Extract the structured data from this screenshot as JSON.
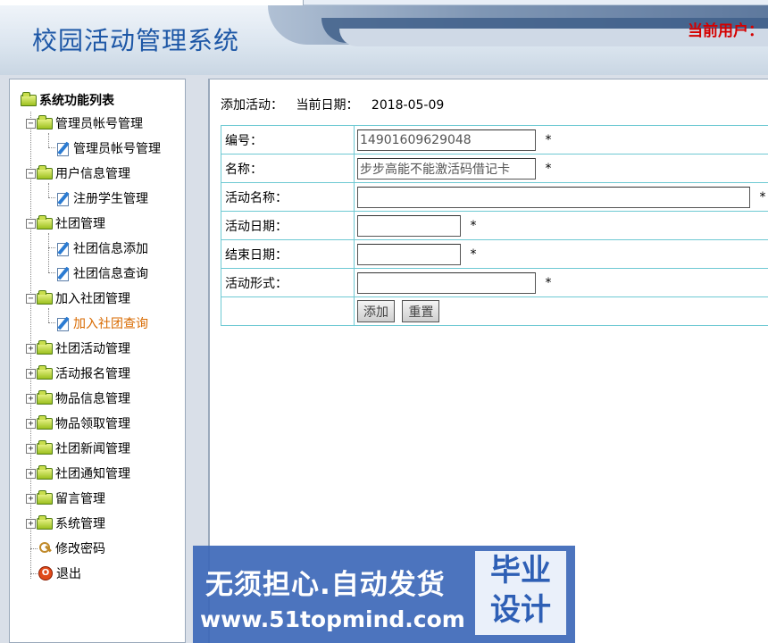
{
  "header": {
    "app_title": "校园活动管理系统",
    "current_user": "当前用户："
  },
  "sidebar": {
    "root_label": "系统功能列表",
    "groups": [
      {
        "label": "管理员帐号管理",
        "expanded": true,
        "children": [
          "管理员帐号管理"
        ]
      },
      {
        "label": "用户信息管理",
        "expanded": true,
        "children": [
          "注册学生管理"
        ]
      },
      {
        "label": "社团管理",
        "expanded": true,
        "children": [
          "社团信息添加",
          "社团信息查询"
        ]
      },
      {
        "label": "加入社团管理",
        "expanded": true,
        "children": [
          "加入社团查询"
        ]
      },
      {
        "label": "社团活动管理",
        "expanded": false
      },
      {
        "label": "活动报名管理",
        "expanded": false
      },
      {
        "label": "物品信息管理",
        "expanded": false
      },
      {
        "label": "物品领取管理",
        "expanded": false
      },
      {
        "label": "社团新闻管理",
        "expanded": false
      },
      {
        "label": "社团通知管理",
        "expanded": false
      },
      {
        "label": "留言管理",
        "expanded": false
      },
      {
        "label": "系统管理",
        "expanded": false
      }
    ],
    "change_password": "修改密码",
    "logout": "退出",
    "active_item": "加入社团查询"
  },
  "main": {
    "section_label": "添加活动：",
    "date_label": "当前日期：",
    "date_value": "2018-05-09",
    "form": {
      "fields": [
        {
          "label": "编号：",
          "value": "14901609629048"
        },
        {
          "label": "名称：",
          "value": "步步高能不能激活码借记卡"
        },
        {
          "label": "活动名称：",
          "value": ""
        },
        {
          "label": "活动日期：",
          "value": ""
        },
        {
          "label": "结束日期：",
          "value": ""
        },
        {
          "label": "活动形式：",
          "value": ""
        }
      ],
      "required_mark": "*",
      "submit_label": "添加",
      "reset_label": "重置"
    }
  },
  "ad": {
    "line1": "无须担心.自动发货",
    "line2": "www.51topmind.com",
    "box_line1": "毕业",
    "box_line2": "设计"
  }
}
